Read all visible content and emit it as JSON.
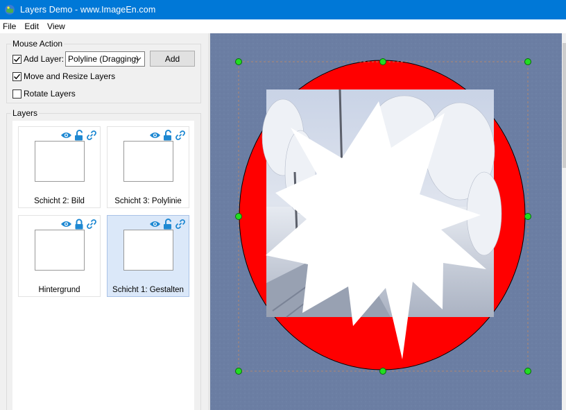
{
  "window": {
    "title": "Layers Demo  - www.ImageEn.com",
    "icon": "app-icon"
  },
  "menu": [
    "File",
    "Edit",
    "View"
  ],
  "mouse_action": {
    "title": "Mouse Action",
    "add_layer_label": "Add Layer:",
    "add_layer_checked": true,
    "combo_value": "Polyline (Dragging)",
    "add_button": "Add",
    "move_resize_label": "Move and Resize Layers",
    "move_resize_checked": true,
    "rotate_label": "Rotate Layers",
    "rotate_checked": false
  },
  "layers_panel": {
    "title": "Layers",
    "items": [
      {
        "label": "Schicht 2: Bild",
        "locked": false,
        "selected": false
      },
      {
        "label": "Schicht 3: Polylinie",
        "locked": false,
        "selected": false
      },
      {
        "label": "Hintergrund",
        "locked": true,
        "selected": false
      },
      {
        "label": "Schicht 1: Gestalten",
        "locked": false,
        "selected": true
      }
    ]
  },
  "colors": {
    "titlebar": "#0078d7",
    "canvas_bg": "#6b7ea3",
    "ellipse": "#ff0000",
    "handle": "#22dd22",
    "icon_blue": "#1e88d2"
  }
}
